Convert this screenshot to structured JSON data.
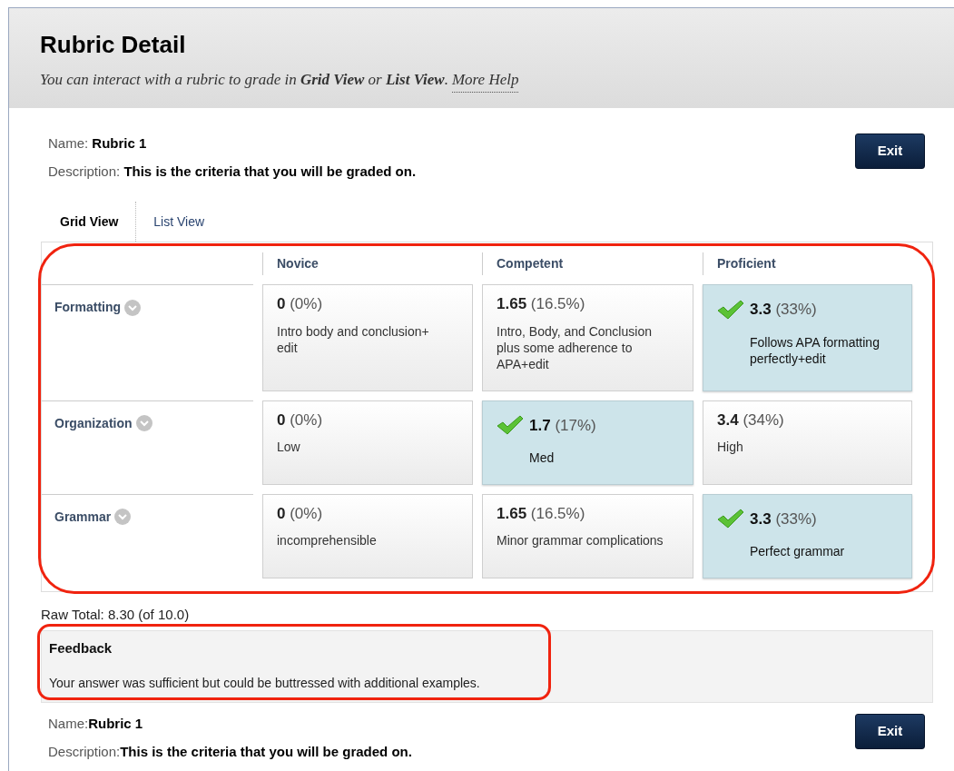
{
  "header": {
    "title": "Rubric Detail",
    "subtitle": "You can interact with a rubric to grade in **Grid View** or **List View**.",
    "help_link": "More Help"
  },
  "rubric": {
    "name_label": "Name:",
    "name": "Rubric 1",
    "description_label": "Description:",
    "description": "This is the criteria that you will be graded on."
  },
  "exit_button": "Exit",
  "tabs": [
    {
      "label": "Grid View",
      "selected": true
    },
    {
      "label": "List View",
      "selected": false
    }
  ],
  "grid": {
    "columns": [
      "Novice",
      "Competent",
      "Proficient"
    ],
    "rows": [
      {
        "criterion": "Formatting",
        "cells": [
          {
            "points": "0",
            "percent": "(0%)",
            "description": "Intro body and conclusion+ edit",
            "selected": false
          },
          {
            "points": "1.65",
            "percent": "(16.5%)",
            "description": "Intro, Body, and Conclusion plus some adherence to APA+edit",
            "selected": false
          },
          {
            "points": "3.3",
            "percent": "(33%)",
            "description": "Follows APA formatting perfectly+edit",
            "selected": true
          }
        ]
      },
      {
        "criterion": "Organization",
        "cells": [
          {
            "points": "0",
            "percent": "(0%)",
            "description": "Low",
            "selected": false
          },
          {
            "points": "1.7",
            "percent": "(17%)",
            "description": "Med",
            "selected": true
          },
          {
            "points": "3.4",
            "percent": "(34%)",
            "description": "High",
            "selected": false
          }
        ]
      },
      {
        "criterion": "Grammar",
        "cells": [
          {
            "points": "0",
            "percent": "(0%)",
            "description": "incomprehensible",
            "selected": false
          },
          {
            "points": "1.65",
            "percent": "(16.5%)",
            "description": "Minor grammar complications",
            "selected": false
          },
          {
            "points": "3.3",
            "percent": "(33%)",
            "description": "Perfect grammar",
            "selected": true
          }
        ]
      }
    ]
  },
  "raw_total": "Raw Total: 8.30 (of 10.0)",
  "feedback": {
    "title": "Feedback",
    "text": "Your answer was sufficient but could be buttressed with additional examples."
  },
  "footer": {
    "name_label": "Name:",
    "name": "Rubric 1",
    "description_label": "Description:",
    "description": "This is the criteria that you will be graded on.",
    "exit_button": "Exit"
  }
}
